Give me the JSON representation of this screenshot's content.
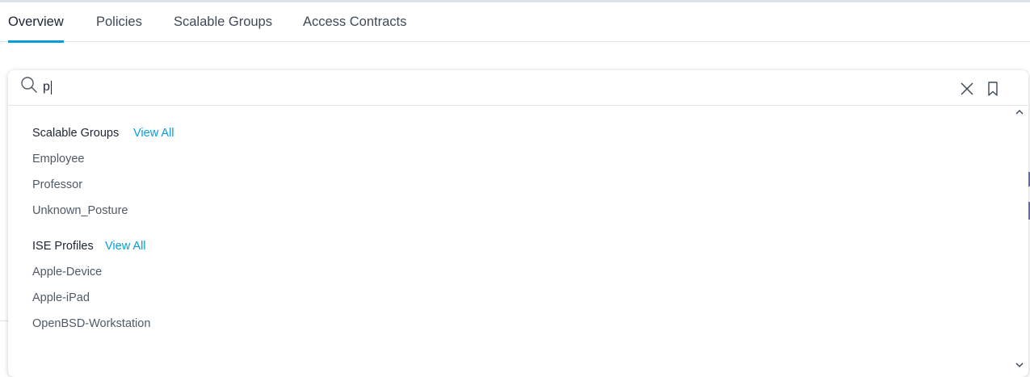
{
  "tabs": [
    {
      "label": "Overview",
      "active": true
    },
    {
      "label": "Policies",
      "active": false
    },
    {
      "label": "Scalable Groups",
      "active": false
    },
    {
      "label": "Access Contracts",
      "active": false
    }
  ],
  "search": {
    "value": "p",
    "icons": {
      "search": "search-icon",
      "clear": "close-icon",
      "bookmark": "bookmark-icon"
    }
  },
  "sections": [
    {
      "title": "Scalable Groups",
      "view_all": "View All",
      "items": [
        "Employee",
        "Professor",
        "Unknown_Posture"
      ]
    },
    {
      "title": "ISE Profiles",
      "view_all": "View All",
      "items": [
        "Apple-Device",
        "Apple-iPad",
        "OpenBSD-Workstation"
      ]
    }
  ],
  "colors": {
    "accent": "#049fd9",
    "text": "#1b2533",
    "muted": "#4e5a66"
  }
}
